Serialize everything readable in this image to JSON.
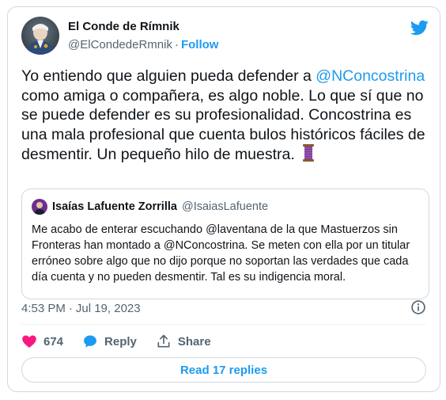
{
  "author": {
    "name": "El Conde de Rímnik",
    "handle": "@ElCondedeRmnik",
    "separator": "·",
    "follow_label": "Follow"
  },
  "tweet": {
    "text_before": "Yo entiendo que alguien pueda defender a ",
    "mention": "@NConcostrina",
    "text_after": " como amiga o compañera, es algo noble. Lo que sí que no se puede defender es su profesionalidad. Concostrina es una mala profesional que cuenta bulos históricos fáciles de desmentir. Un pequeño hilo de muestra. ",
    "emoji_icon": "thread-spool-icon"
  },
  "quote": {
    "name": "Isaías Lafuente Zorrilla",
    "handle": "@IsaiasLafuente",
    "text": "Me acabo de enterar escuchando @laventana de la que Mastuerzos sin Fronteras han montado a @NConcostrina. Se meten con ella por un titular erróneo sobre algo que no dijo porque no soportan las verdades que cada día cuenta y no pueden desmentir. Tal es su indigencia moral."
  },
  "meta": {
    "time": "4:53 PM",
    "separator": "·",
    "date": "Jul 19, 2023"
  },
  "actions": {
    "like_count": "674",
    "reply_label": "Reply",
    "share_label": "Share"
  },
  "read_replies_label": "Read 17 replies",
  "colors": {
    "accent": "#1d9bf0",
    "like": "#f91880",
    "muted": "#536471",
    "border": "#cfd9de"
  }
}
